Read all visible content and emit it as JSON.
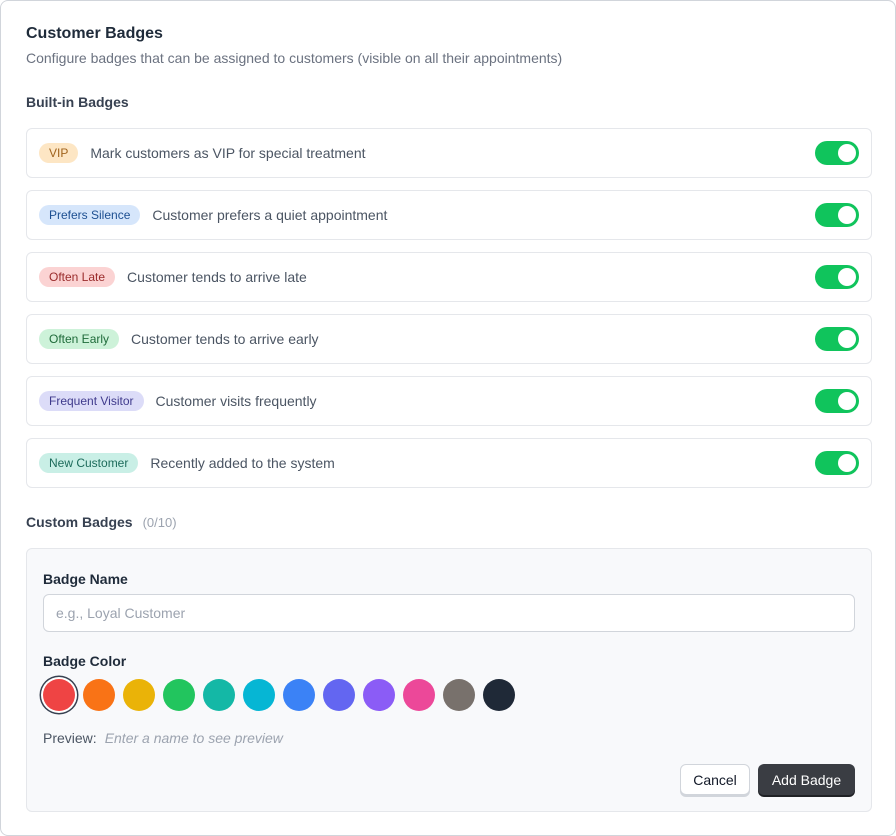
{
  "header": {
    "title": "Customer Badges",
    "subtitle": "Configure badges that can be assigned to customers (visible on all their appointments)"
  },
  "builtin": {
    "label": "Built-in Badges",
    "items": [
      {
        "name": "VIP",
        "description": "Mark customers as VIP for special treatment",
        "bg": "#fde6c4",
        "fg": "#a0631c",
        "enabled": true
      },
      {
        "name": "Prefers Silence",
        "description": "Customer prefers a quiet appointment",
        "bg": "#d6e6fb",
        "fg": "#1d4f91",
        "enabled": true
      },
      {
        "name": "Often Late",
        "description": "Customer tends to arrive late",
        "bg": "#fbd3d3",
        "fg": "#9b2c2c",
        "enabled": true
      },
      {
        "name": "Often Early",
        "description": "Customer tends to arrive early",
        "bg": "#cdf2d9",
        "fg": "#1f6b3a",
        "enabled": true
      },
      {
        "name": "Frequent Visitor",
        "description": "Customer visits frequently",
        "bg": "#dcdcf8",
        "fg": "#3f3a8c",
        "enabled": true
      },
      {
        "name": "New Customer",
        "description": "Recently added to the system",
        "bg": "#c9efe6",
        "fg": "#1d6b5b",
        "enabled": true
      }
    ]
  },
  "custom": {
    "label": "Custom Badges",
    "count": "(0/10)",
    "name_label": "Badge Name",
    "name_placeholder": "e.g., Loyal Customer",
    "name_value": "",
    "color_label": "Badge Color",
    "colors": [
      "#ef4444",
      "#f97316",
      "#eab308",
      "#22c55e",
      "#14b8a6",
      "#06b6d4",
      "#3b82f6",
      "#6366f1",
      "#8b5cf6",
      "#ec4899",
      "#78716c",
      "#1f2937"
    ],
    "selected_color": "#ef4444",
    "preview_label": "Preview:",
    "preview_hint": "Enter a name to see preview",
    "cancel_label": "Cancel",
    "add_label": "Add Badge"
  }
}
